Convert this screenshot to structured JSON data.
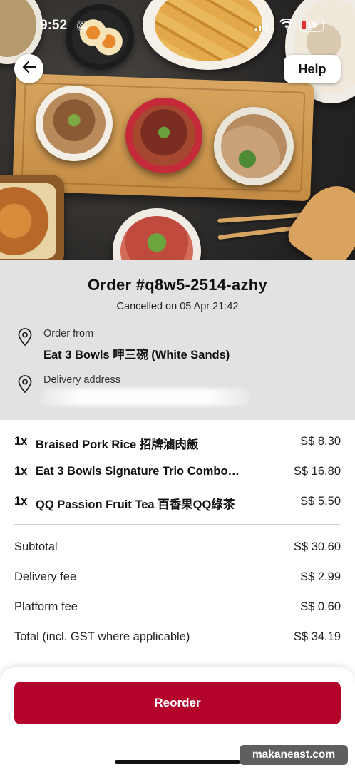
{
  "status_bar": {
    "time": "9:52",
    "battery_level": "19"
  },
  "header": {
    "back_icon": "arrow-left-icon",
    "help_label": "Help"
  },
  "order": {
    "title": "Order #q8w5-2514-azhy",
    "status_line": "Cancelled on 05 Apr 21:42",
    "from_label": "Order from",
    "restaurant_name": "Eat 3 Bowls 呷三碗 (White Sands)",
    "delivery_label": "Delivery address"
  },
  "items": [
    {
      "qty": "1x",
      "name": "Braised Pork Rice 招牌滷肉飯",
      "price": "S$ 8.30"
    },
    {
      "qty": "1x",
      "name": "Eat 3 Bowls Signature Trio Combo…",
      "price": "S$ 16.80"
    },
    {
      "qty": "1x",
      "name": "QQ Passion Fruit Tea 百香果QQ綠茶",
      "price": "S$ 5.50"
    }
  ],
  "summary": {
    "subtotal_label": "Subtotal",
    "subtotal_value": "S$ 30.60",
    "delivery_fee_label": "Delivery fee",
    "delivery_fee_value": "S$ 2.99",
    "platform_fee_label": "Platform fee",
    "platform_fee_value": "S$ 0.60",
    "total_label": "Total (incl. GST where applicable)",
    "total_value": "S$ 34.19"
  },
  "footer": {
    "reorder_label": "Reorder"
  },
  "watermark": "makaneast.com",
  "colors": {
    "accent": "#b3032a",
    "panel_bg": "#e2e2e2"
  }
}
